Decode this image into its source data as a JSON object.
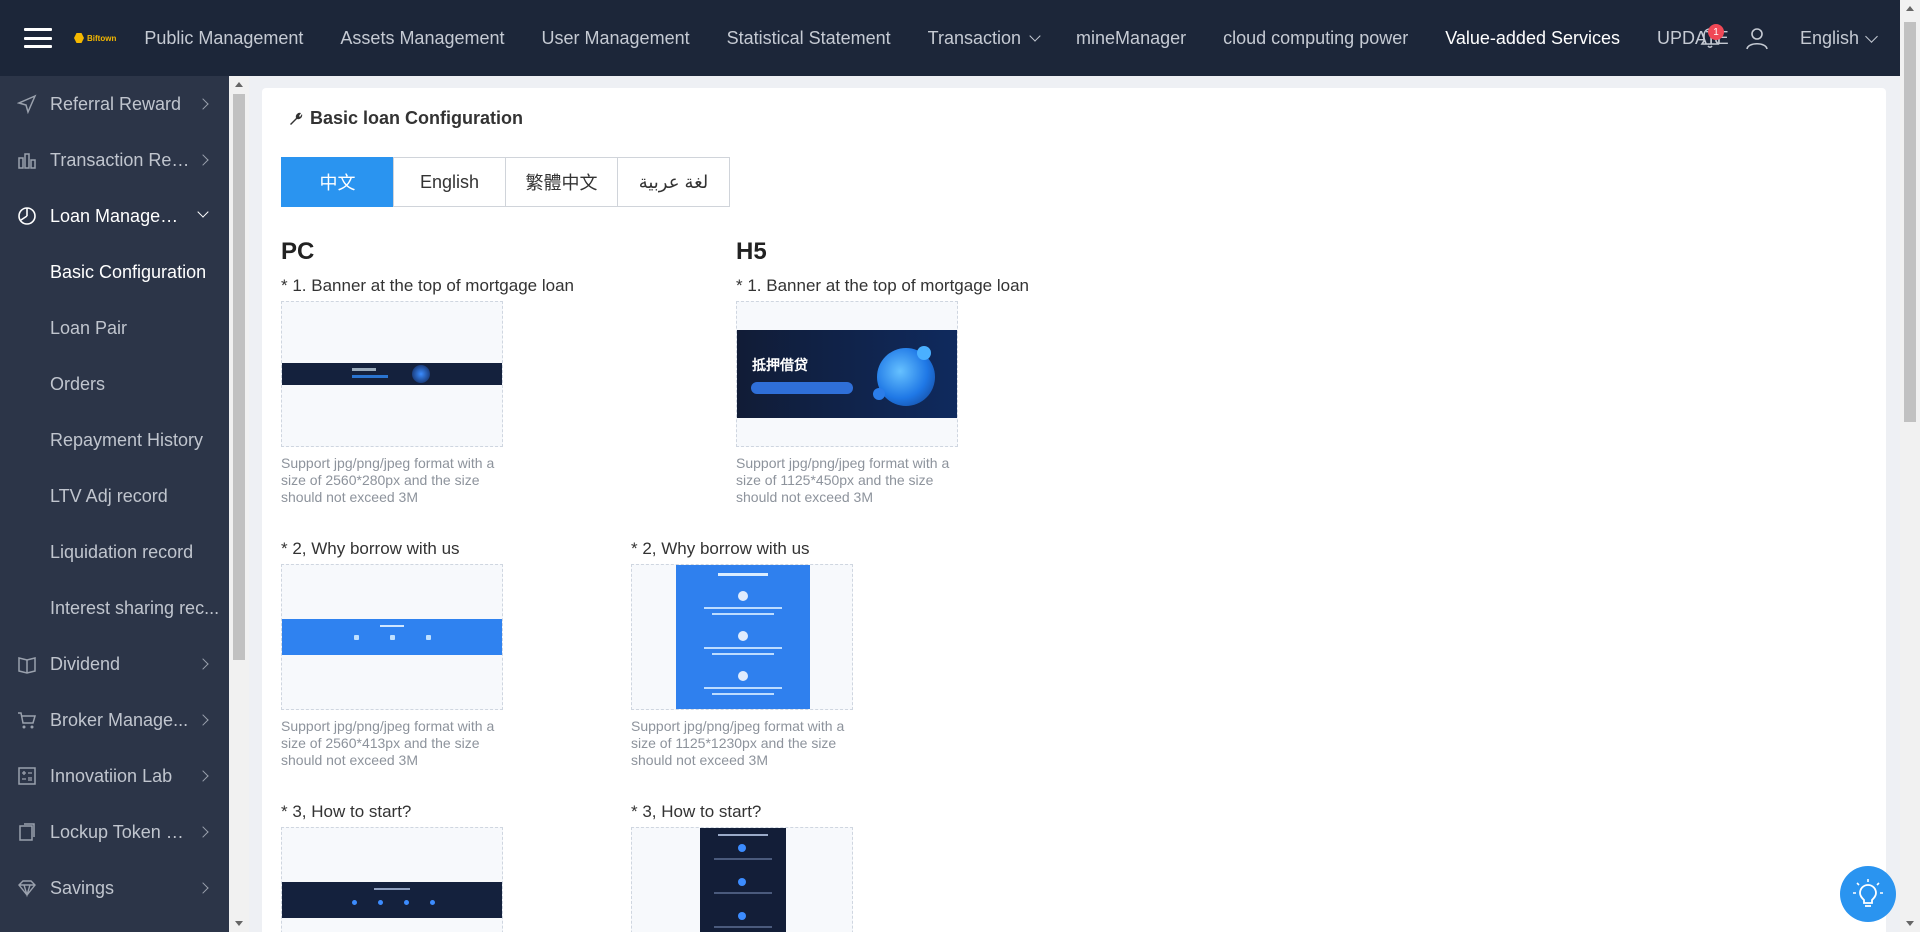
{
  "topbar": {
    "logo_text": "Biftown",
    "nav": [
      {
        "label": "Public Management"
      },
      {
        "label": "Assets Management"
      },
      {
        "label": "User Management"
      },
      {
        "label": "Statistical Statement"
      },
      {
        "label": "Transaction"
      },
      {
        "label": "mineManager"
      },
      {
        "label": "cloud computing power"
      },
      {
        "label": "Value-added Services"
      },
      {
        "label": "UPDATE"
      }
    ],
    "notification_count": "1",
    "language": "English"
  },
  "sidebar": {
    "items": [
      {
        "label": "Referral Reward",
        "icon": "send-icon"
      },
      {
        "label": "Transaction Rew...",
        "icon": "bar-chart-icon"
      },
      {
        "label": "Loan Manageme...",
        "icon": "pie-icon"
      },
      {
        "label": "Dividend",
        "icon": "book-icon"
      },
      {
        "label": "Broker Manage...",
        "icon": "cart-icon"
      },
      {
        "label": "Innovatiion Lab",
        "icon": "calculator-icon"
      },
      {
        "label": "Lockup Token Mgt",
        "icon": "clipboard-icon"
      },
      {
        "label": "Savings",
        "icon": "diamond-icon"
      }
    ],
    "submenu": [
      {
        "label": "Basic Configuration"
      },
      {
        "label": "Loan Pair"
      },
      {
        "label": "Orders"
      },
      {
        "label": "Repayment History"
      },
      {
        "label": "LTV Adj record"
      },
      {
        "label": "Liquidation record"
      },
      {
        "label": "Interest sharing rec..."
      }
    ]
  },
  "main": {
    "title": "Basic loan Configuration",
    "tabs": [
      {
        "label": "中文"
      },
      {
        "label": "English"
      },
      {
        "label": "繁體中文"
      },
      {
        "label": "لغة عربية"
      }
    ],
    "pc": {
      "heading": "PC",
      "fields": [
        {
          "label": "* 1. Banner at the top of mortgage loan",
          "hint": "Support jpg/png/jpeg format with a size of 2560*280px and the size should not exceed 3M"
        },
        {
          "label": "* 2, Why borrow with us",
          "hint": "Support jpg/png/jpeg format with a size of 2560*413px and the size should not exceed 3M"
        },
        {
          "label": "* 3, How to start?"
        }
      ]
    },
    "h5": {
      "heading": "H5",
      "fields": [
        {
          "label": "* 1. Banner at the top of mortgage loan",
          "hint": "Support jpg/png/jpeg format with a size of 1125*450px and the size should not exceed 3M",
          "banner_title": "抵押借贷"
        },
        {
          "label": "* 2, Why borrow with us",
          "hint": "Support jpg/png/jpeg format with a size of 1125*1230px and the size should not exceed 3M"
        },
        {
          "label": "* 3, How to start?"
        }
      ]
    }
  },
  "colors": {
    "topbar_bg": "#1c2639",
    "sidebar_bg": "#2c3548",
    "accent": "#2a94f0",
    "badge": "#f04856"
  }
}
